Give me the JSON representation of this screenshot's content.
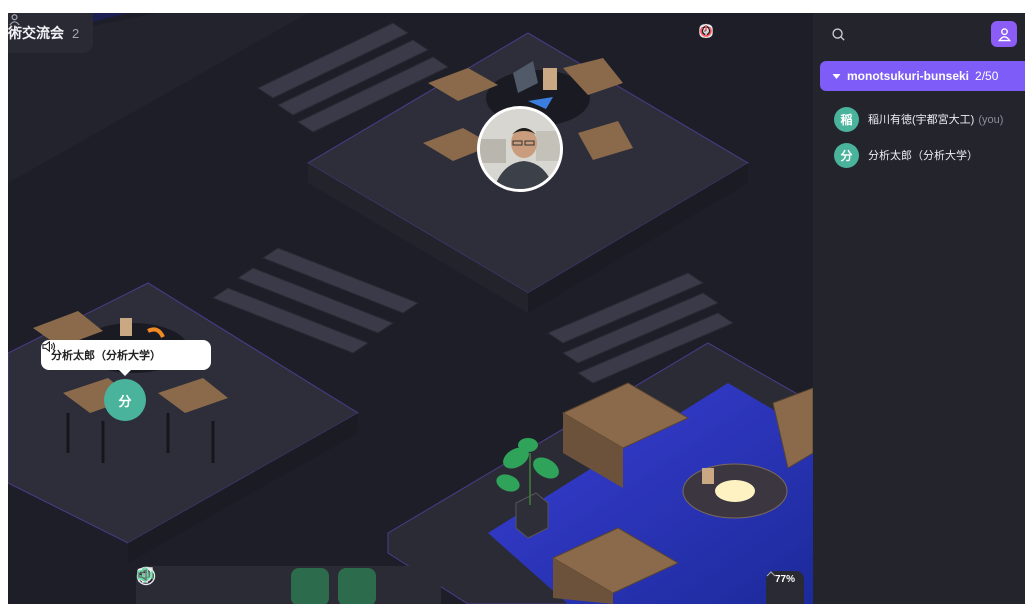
{
  "room": {
    "title": "術交流会",
    "participant_count": "2"
  },
  "sidebar": {
    "group": {
      "name": "monotsukuri-bunseki",
      "count": "2/50"
    },
    "members": [
      {
        "initial": "稲",
        "name": "稲川有徳(宇都宮大工)",
        "suffix": "(you)"
      },
      {
        "initial": "分",
        "name": "分析太郎（分析大学）",
        "suffix": ""
      }
    ]
  },
  "map": {
    "popup_name": "分析太郎（分析大学）",
    "avatar_initial": "分",
    "zoom": "77%"
  },
  "icons": {
    "top": [
      "settings-icon",
      "help-icon",
      "power-icon"
    ],
    "toolbar": [
      "add-icon",
      "screen-share-icon",
      "chat-icon",
      "camera-icon",
      "microphone-icon",
      "speaker-icon"
    ]
  },
  "colors": {
    "accent": "#7d5cf7",
    "avatar": "#49b39b",
    "active_button": "#2c6b4b",
    "power": "#ff5a5a"
  }
}
